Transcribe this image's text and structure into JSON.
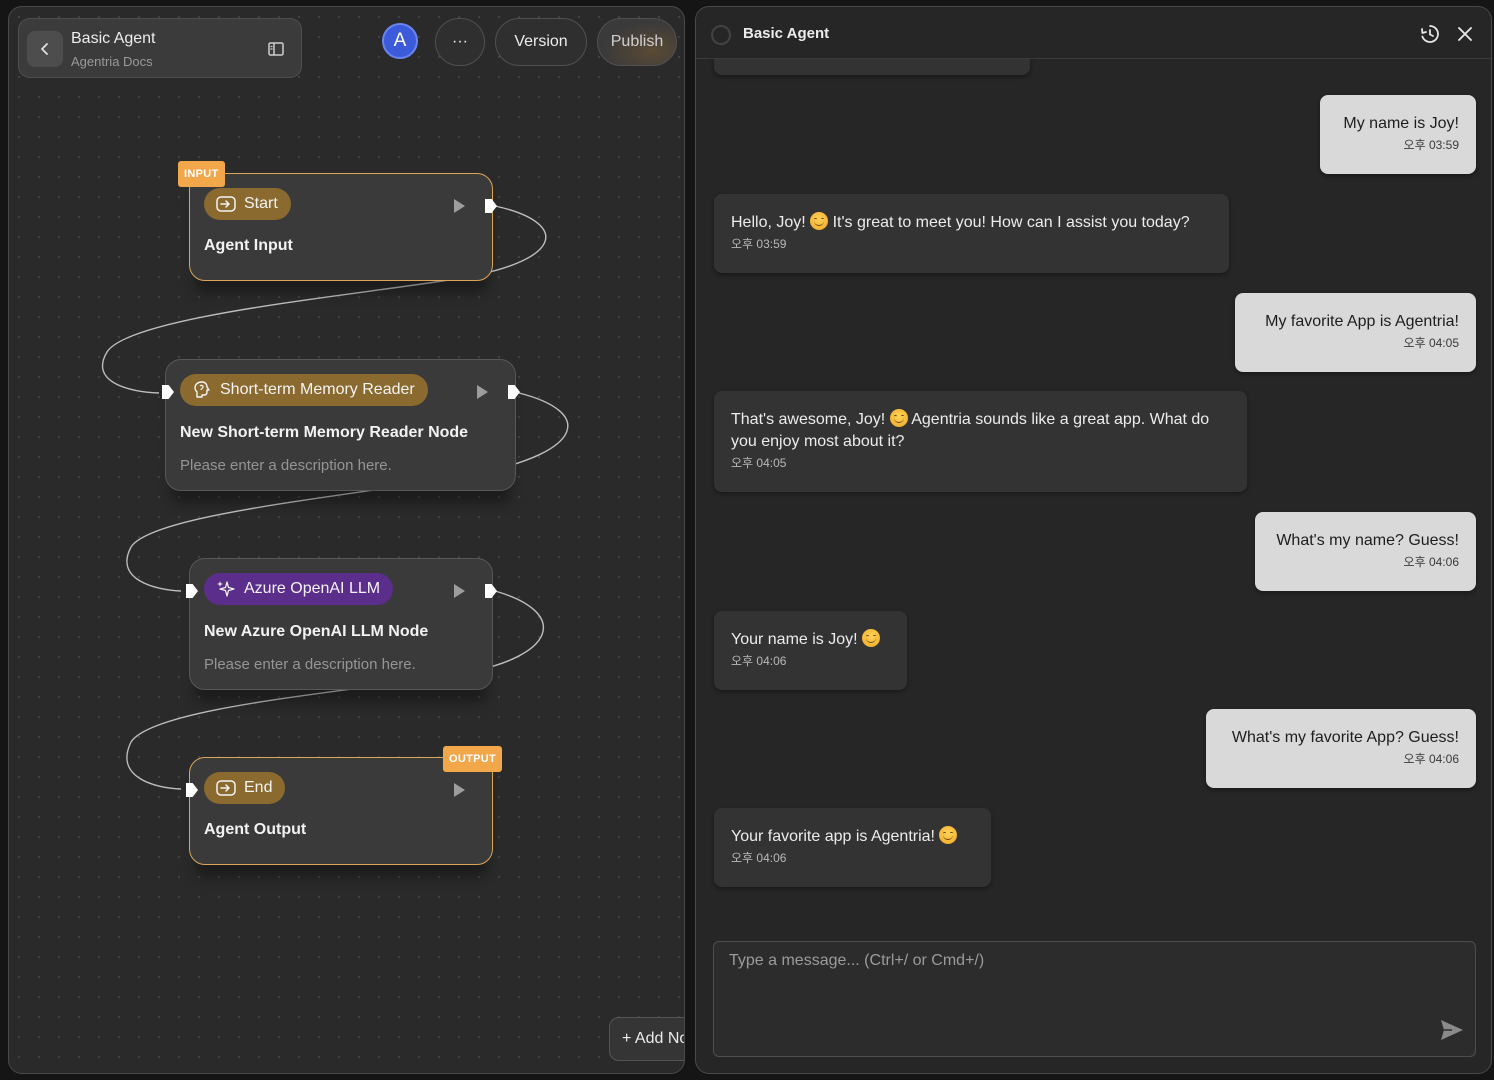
{
  "app": {
    "title": "Basic Agent",
    "subtitle": "Agentria Docs",
    "avatar_initial": "A",
    "more_label": "···",
    "version_label": "Version",
    "publish_label": "Publish",
    "add_node_label": "+ Add Node"
  },
  "nodes": {
    "start": {
      "tag": "INPUT",
      "badge": "Start",
      "title": "Agent Input"
    },
    "memory": {
      "badge": "Short-term Memory Reader",
      "title": "New Short-term Memory Reader Node",
      "description": "Please enter a description here."
    },
    "llm": {
      "badge": "Azure OpenAI LLM",
      "title": "New Azure OpenAI LLM Node",
      "description": "Please enter a description here."
    },
    "end": {
      "tag": "OUTPUT",
      "badge": "End",
      "title": "Agent Output"
    }
  },
  "chat": {
    "title": "Basic Agent",
    "placeholder": "Type a message... (Ctrl+/ or Cmd+/)",
    "messages": [
      {
        "role": "user",
        "text": "My name is Joy!",
        "time": "오후 03:59"
      },
      {
        "role": "bot",
        "text": "Hello, Joy! 😊 It's great to meet you! How can I assist you today?",
        "time": "오후 03:59"
      },
      {
        "role": "user",
        "text": "My favorite App is Agentria!",
        "time": "오후 04:05"
      },
      {
        "role": "bot",
        "text": "That's awesome, Joy! 😊 Agentria sounds like a great app. What do you enjoy most about it?",
        "time": "오후 04:05"
      },
      {
        "role": "user",
        "text": "What's my name? Guess!",
        "time": "오후 04:06"
      },
      {
        "role": "bot",
        "text": "Your name is Joy! 😊",
        "time": "오후 04:06"
      },
      {
        "role": "user",
        "text": "What's my favorite App? Guess!",
        "time": "오후 04:06"
      },
      {
        "role": "bot",
        "text": "Your favorite app is Agentria! 😊",
        "time": "오후 04:06"
      }
    ]
  },
  "colors": {
    "io_border": "#d9a65a",
    "tag_bg": "#f2a74b",
    "gold_badge": "#8a6a2e",
    "purple_badge": "#5a2e8a",
    "avatar_bg": "#3b5bdb"
  },
  "icons": [
    "chevron-left-icon",
    "panel-layout-icon",
    "enter-icon",
    "brain-icon",
    "sparkles-icon",
    "play-icon",
    "history-icon",
    "close-icon",
    "send-icon"
  ]
}
